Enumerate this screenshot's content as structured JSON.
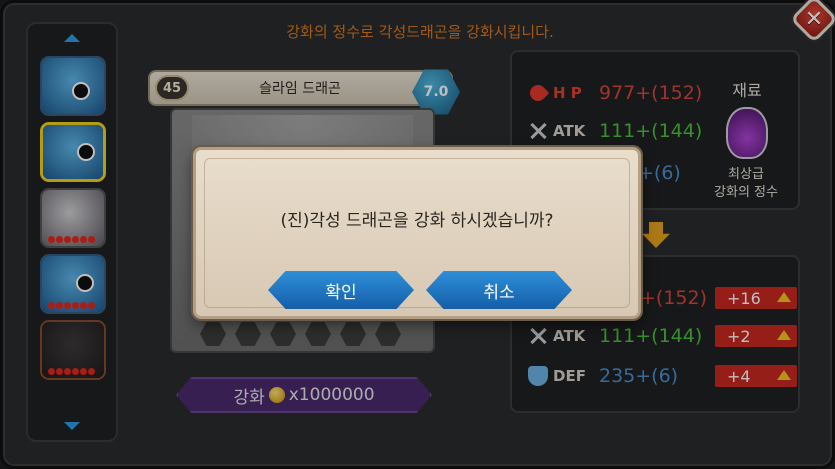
{
  "header": {
    "message": "강화의 정수로 각성드래곤을 강화시킵니다.",
    "close_symbol": "✕"
  },
  "card": {
    "level": "45",
    "name": "슬라임 드래곤",
    "grade": "7.0",
    "enhance_label": "강화",
    "enhance_cost": "x1000000"
  },
  "stats_current": {
    "hp_label": "H P",
    "hp_value": "977+(152)",
    "atk_label": "ATK",
    "atk_value": "111+(144)",
    "def_value": "+(6)"
  },
  "material": {
    "title": "재료",
    "name_line1": "최상급",
    "name_line2": "강화의 정수"
  },
  "stats_next": {
    "hp_value": "+(152)",
    "hp_bonus": "+16",
    "atk_label": "ATK",
    "atk_value": "111+(144)",
    "atk_bonus": "+2",
    "def_label": "DEF",
    "def_value": "235+(6)",
    "def_bonus": "+4"
  },
  "modal": {
    "message": "(진)각성 드래곤을 강화 하시겠습니까?",
    "confirm_label": "확인",
    "cancel_label": "취소"
  },
  "colors": {
    "hp_red": "#d5463a",
    "atk_green": "#4bbf3b",
    "def_blue": "#4a8fd1",
    "button_blue": "#2f8fd9",
    "enhance_purple": "#4a2a6e",
    "selected_slot": "#f0d11b"
  }
}
